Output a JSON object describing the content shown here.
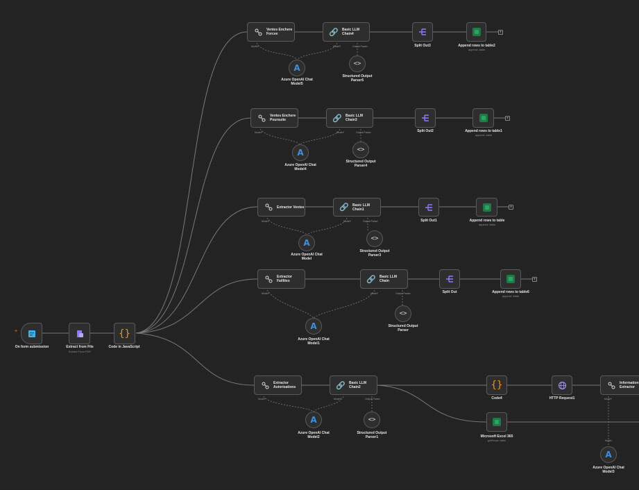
{
  "colors": {
    "background": "#232323",
    "node_bg": "#2e2e2e",
    "node_border": "#5a5a5a",
    "wire": "#7a7a7a",
    "azure": "#3d8fe0",
    "excel": "#1f7a45",
    "code_orange": "#e8922e",
    "split_purple": "#8a7cff",
    "trigger_blue": "#3fb0e8"
  },
  "icons": {
    "trigger": "form-icon",
    "extract": "file-extract-icon",
    "code": "braces-icon",
    "extractor": "extractor-icon",
    "chain": "link-icon",
    "split": "split-icon",
    "excel": "excel-icon",
    "azure": "azure-icon",
    "parser": "brackets-icon",
    "http": "globe-icon"
  },
  "ports": {
    "model": "Model*",
    "model_plain": "Model",
    "output_parser": "Output Parser"
  },
  "main_flow": {
    "trigger": {
      "label": "On form submission",
      "plus": "+"
    },
    "extract": {
      "label": "Extract from File",
      "sub": "Extract From PDF"
    },
    "code": {
      "label": "Code in JavaScript"
    }
  },
  "rows": [
    {
      "extractor": "Ventes Enchere\nForcee",
      "chain": "Basic LLM\nChain4",
      "split": "Split Out3",
      "append": "Append rows to table2",
      "append_sub": "append: table",
      "model": "Azure OpenAI Chat\nModel5",
      "parser": "Structured Output\nParser5"
    },
    {
      "extractor": "Ventes Enchere\nPoursuite",
      "chain": "Basic LLM\nChain3",
      "split": "Split Out2",
      "append": "Append rows to table1",
      "append_sub": "append: table",
      "model": "Azure OpenAI Chat\nModel4",
      "parser": "Structured Output\nParser4"
    },
    {
      "extractor": "Extractor Ventes",
      "chain": "Basic LLM\nChain1",
      "split": "Split Out1",
      "append": "Append rows to table",
      "append_sub": "append: table",
      "model": "Azure OpenAI Chat\nModel",
      "parser": "Structured Output\nParser3"
    },
    {
      "extractor": "Extractor\nFaillites",
      "chain": "Basic LLM Chain",
      "split": "Split Out",
      "append": "Append rows to table6",
      "append_sub": "append: table",
      "model": "Azure OpenAI Chat\nModel1",
      "parser": "Structured Output\nParser"
    },
    {
      "extractor": "Extractor\nAutorisations",
      "chain": "Basic LLM\nChain2",
      "model": "Azure OpenAI Chat\nModel2",
      "parser": "Structured Output\nParser1"
    }
  ],
  "tail": {
    "code4": "Code4",
    "http": "HTTP Request1",
    "info": "Information\nExtractor",
    "excel365": "Microsoft Excel 365",
    "excel365_sub": "getRows: table",
    "model3": "Azure OpenAI Chat\nModel3"
  }
}
